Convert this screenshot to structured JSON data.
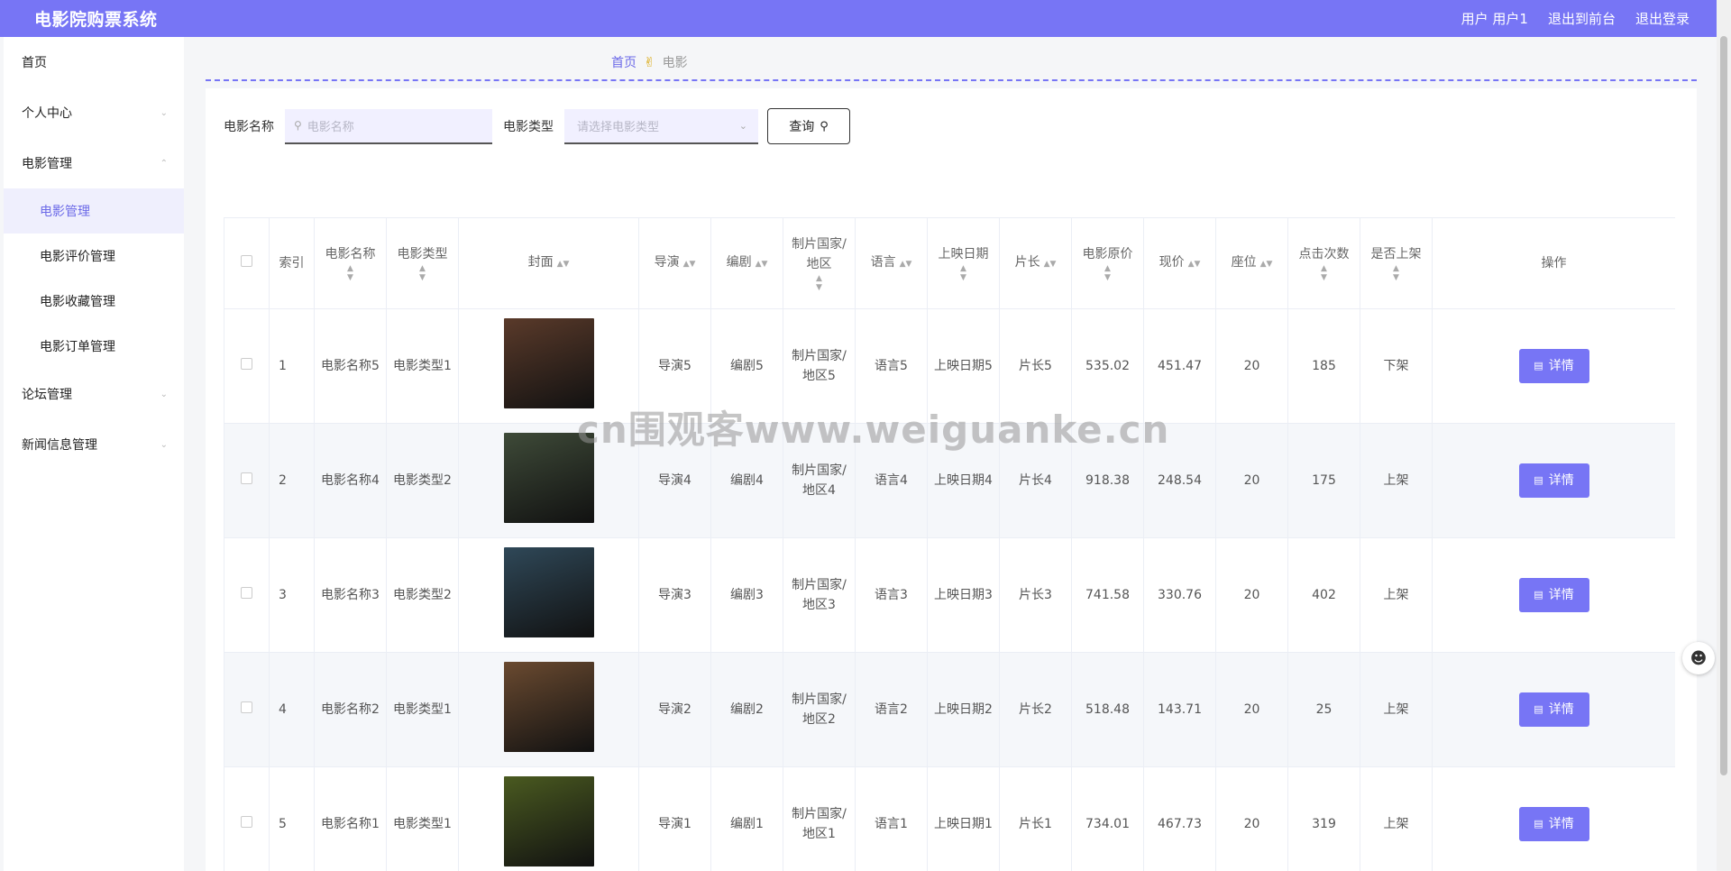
{
  "header": {
    "title": "电影院购票系统",
    "user_label": "用户 用户1",
    "front_label": "退出到前台",
    "logout_label": "退出登录"
  },
  "sidebar": {
    "items": [
      {
        "label": "首页",
        "has_chevron": false
      },
      {
        "label": "个人中心",
        "has_chevron": true
      },
      {
        "label": "电影管理",
        "has_chevron": true,
        "expanded": true
      }
    ],
    "movie_sub": [
      {
        "label": "电影管理",
        "active": true
      },
      {
        "label": "电影评价管理"
      },
      {
        "label": "电影收藏管理"
      },
      {
        "label": "电影订单管理"
      }
    ],
    "items_after": [
      {
        "label": "论坛管理"
      },
      {
        "label": "新闻信息管理"
      }
    ]
  },
  "breadcrumb": {
    "home": "首页",
    "current": "电影"
  },
  "search": {
    "name_label": "电影名称",
    "name_placeholder": "电影名称",
    "type_label": "电影类型",
    "type_placeholder": "请选择电影类型",
    "query_label": "查询"
  },
  "table": {
    "headers": {
      "index": "索引",
      "name": "电影名称",
      "type": "电影类型",
      "cover": "封面",
      "director": "导演",
      "writer": "编剧",
      "country": "制片国家/地区",
      "language": "语言",
      "release": "上映日期",
      "duration": "片长",
      "orig_price": "电影原价",
      "price": "现价",
      "seats": "座位",
      "clicks": "点击次数",
      "listed": "是否上架",
      "action": "操作"
    },
    "detail_label": "详情",
    "rows": [
      {
        "index": "1",
        "name": "电影名称5",
        "type": "电影类型1",
        "director": "导演5",
        "writer": "编剧5",
        "country": "制片国家/地区5",
        "language": "语言5",
        "release": "上映日期5",
        "duration": "片长5",
        "orig_price": "535.02",
        "price": "451.47",
        "seats": "20",
        "clicks": "185",
        "listed": "下架",
        "cover_color": "#5a3a2a"
      },
      {
        "index": "2",
        "name": "电影名称4",
        "type": "电影类型2",
        "director": "导演4",
        "writer": "编剧4",
        "country": "制片国家/地区4",
        "language": "语言4",
        "release": "上映日期4",
        "duration": "片长4",
        "orig_price": "918.38",
        "price": "248.54",
        "seats": "20",
        "clicks": "175",
        "listed": "上架",
        "cover_color": "#3e4a38"
      },
      {
        "index": "3",
        "name": "电影名称3",
        "type": "电影类型2",
        "director": "导演3",
        "writer": "编剧3",
        "country": "制片国家/地区3",
        "language": "语言3",
        "release": "上映日期3",
        "duration": "片长3",
        "orig_price": "741.58",
        "price": "330.76",
        "seats": "20",
        "clicks": "402",
        "listed": "上架",
        "cover_color": "#2f4858"
      },
      {
        "index": "4",
        "name": "电影名称2",
        "type": "电影类型1",
        "director": "导演2",
        "writer": "编剧2",
        "country": "制片国家/地区2",
        "language": "语言2",
        "release": "上映日期2",
        "duration": "片长2",
        "orig_price": "518.48",
        "price": "143.71",
        "seats": "20",
        "clicks": "25",
        "listed": "上架",
        "cover_color": "#6a4a30"
      },
      {
        "index": "5",
        "name": "电影名称1",
        "type": "电影类型1",
        "director": "导演1",
        "writer": "编剧1",
        "country": "制片国家/地区1",
        "language": "语言1",
        "release": "上映日期1",
        "duration": "片长1",
        "orig_price": "734.01",
        "price": "467.73",
        "seats": "20",
        "clicks": "319",
        "listed": "上架",
        "cover_color": "#4a5a20"
      }
    ]
  },
  "watermark": "cn围观客www.weiguanke.cn",
  "colors": {
    "accent": "#7775f5",
    "active_bg": "#efeffd"
  }
}
